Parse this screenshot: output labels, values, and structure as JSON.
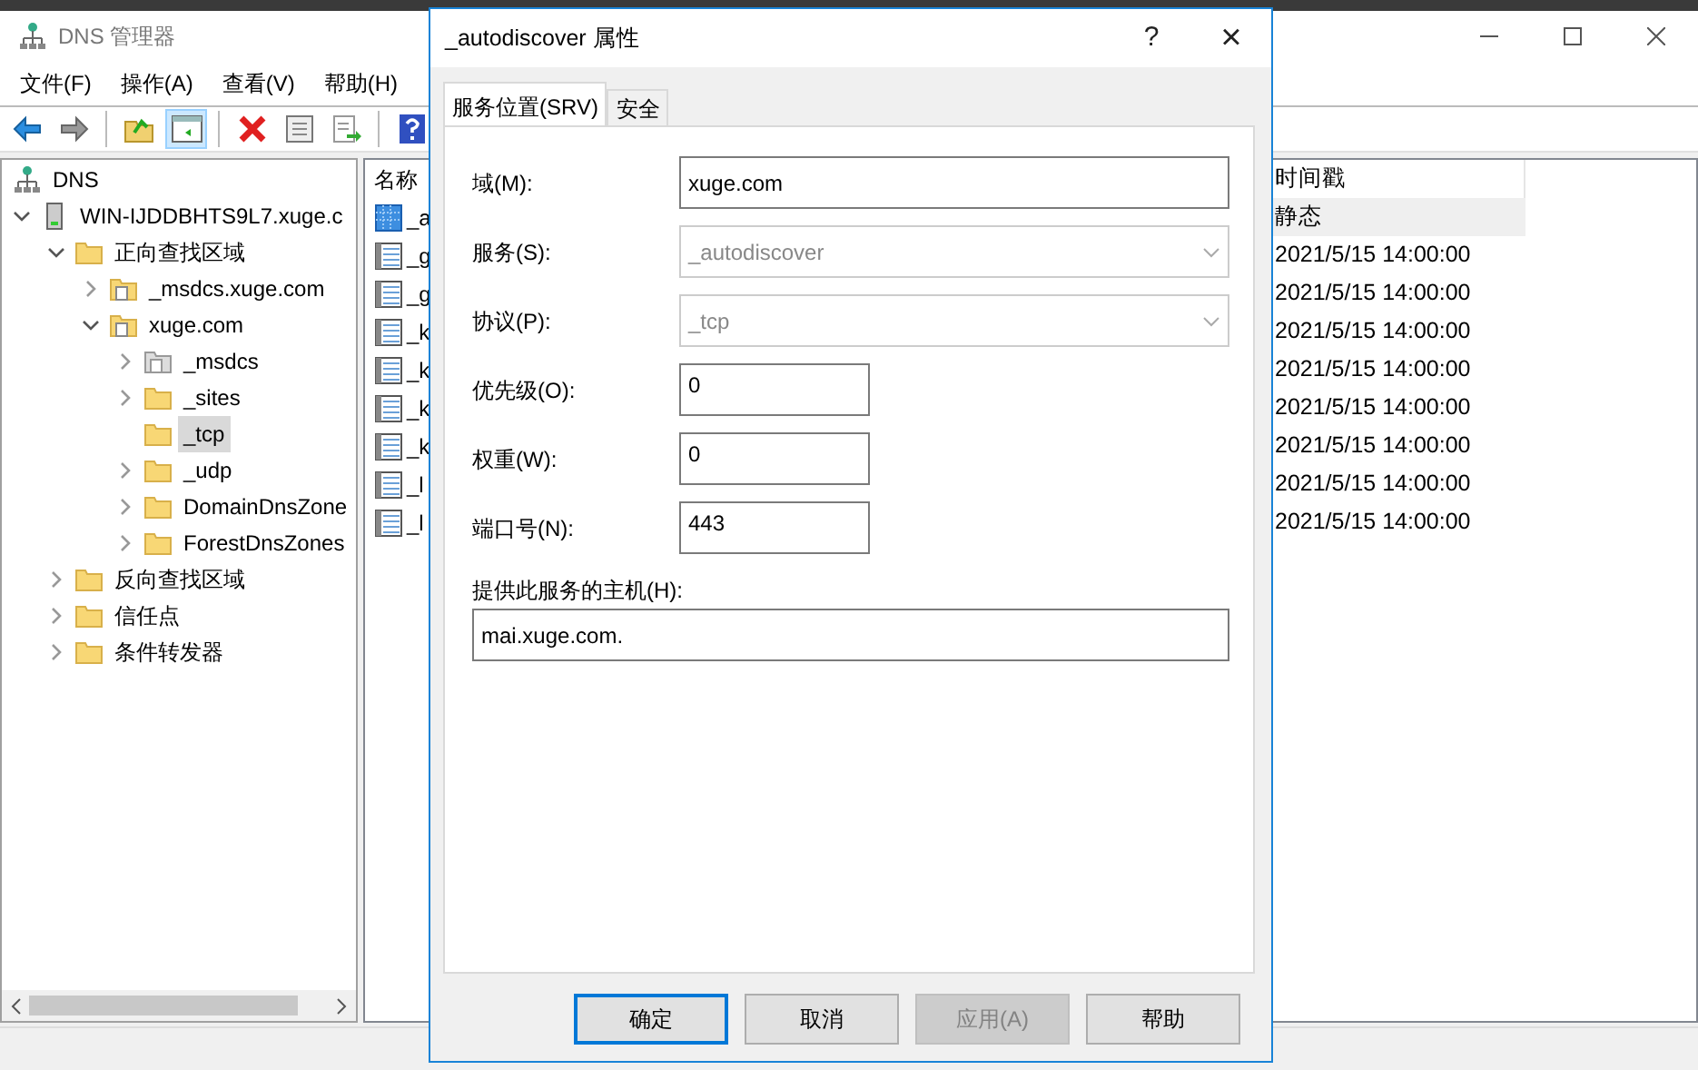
{
  "window": {
    "title": "DNS 管理器"
  },
  "menu": [
    "文件(F)",
    "操作(A)",
    "查看(V)",
    "帮助(H)"
  ],
  "toolbar": [
    {
      "kind": "back",
      "selected": false
    },
    {
      "kind": "forward",
      "selected": false
    },
    {
      "kind": "separator"
    },
    {
      "kind": "up",
      "selected": false
    },
    {
      "kind": "pane",
      "selected": true
    },
    {
      "kind": "separator"
    },
    {
      "kind": "delete",
      "selected": false
    },
    {
      "kind": "properties",
      "selected": false
    },
    {
      "kind": "export",
      "selected": false
    },
    {
      "kind": "separator"
    },
    {
      "kind": "help",
      "selected": false
    }
  ],
  "tree": [
    {
      "label": "DNS",
      "kind": "dns",
      "selected": false,
      "children": [
        {
          "label": "WIN-IJDDBHTS9L7.xuge.c",
          "kind": "server",
          "selected": false,
          "expanded": true,
          "children": [
            {
              "label": "正向查找区域",
              "kind": "folder",
              "selected": false,
              "expanded": true,
              "children": [
                {
                  "label": "_msdcs.xuge.com",
                  "kind": "zone",
                  "selected": false,
                  "expanded": false
                },
                {
                  "label": "xuge.com",
                  "kind": "zone",
                  "selected": false,
                  "expanded": true,
                  "children": [
                    {
                      "label": "_msdcs",
                      "kind": "delegated",
                      "selected": false,
                      "expanded": false
                    },
                    {
                      "label": "_sites",
                      "kind": "folder",
                      "selected": false,
                      "expanded": false
                    },
                    {
                      "label": "_tcp",
                      "kind": "folder",
                      "selected": true
                    },
                    {
                      "label": "_udp",
                      "kind": "folder",
                      "selected": false,
                      "expanded": false
                    },
                    {
                      "label": "DomainDnsZone",
                      "kind": "folder",
                      "selected": false,
                      "expanded": false
                    },
                    {
                      "label": "ForestDnsZones",
                      "kind": "folder",
                      "selected": false,
                      "expanded": false
                    }
                  ]
                }
              ]
            },
            {
              "label": "反向查找区域",
              "kind": "folder",
              "selected": false,
              "expanded": false
            },
            {
              "label": "信任点",
              "kind": "folder",
              "selected": false,
              "expanded": false
            },
            {
              "label": "条件转发器",
              "kind": "folder",
              "selected": false,
              "expanded": false
            }
          ]
        }
      ]
    }
  ],
  "list": {
    "columns": [
      "名称",
      "时间戳"
    ],
    "rows": [
      {
        "name": "_a",
        "timestamp": "静态",
        "selected": true
      },
      {
        "name": "_g",
        "timestamp": "2021/5/15 14:00:00",
        "selected": false
      },
      {
        "name": "_g",
        "timestamp": "2021/5/15 14:00:00",
        "selected": false
      },
      {
        "name": "_k",
        "timestamp": "2021/5/15 14:00:00",
        "selected": false
      },
      {
        "name": "_k",
        "timestamp": "2021/5/15 14:00:00",
        "selected": false
      },
      {
        "name": "_k",
        "timestamp": "2021/5/15 14:00:00",
        "selected": false
      },
      {
        "name": "_k",
        "timestamp": "2021/5/15 14:00:00",
        "selected": false
      },
      {
        "name": "_l",
        "timestamp": "2021/5/15 14:00:00",
        "selected": false
      },
      {
        "name": "_l",
        "timestamp": "2021/5/15 14:00:00",
        "selected": false
      }
    ]
  },
  "dialog": {
    "title": "_autodiscover 属性",
    "help": "?",
    "close": "×",
    "tabs": [
      {
        "label": "服务位置(SRV)",
        "selected": true
      },
      {
        "label": "安全",
        "selected": false
      }
    ],
    "fields": [
      {
        "kind": "text",
        "label": "域(M):",
        "value": "xuge.com",
        "disabled": false
      },
      {
        "kind": "select",
        "label": "服务(S):",
        "value": "_autodiscover",
        "disabled": true
      },
      {
        "kind": "select",
        "label": "协议(P):",
        "value": "_tcp",
        "disabled": true
      },
      {
        "kind": "short",
        "label": "优先级(O):",
        "value": "0",
        "disabled": false
      },
      {
        "kind": "short",
        "label": "权重(W):",
        "value": "0",
        "disabled": false
      },
      {
        "kind": "short",
        "label": "端口号(N):",
        "value": "443",
        "disabled": false
      },
      {
        "kind": "block",
        "label": "提供此服务的主机(H):",
        "value": "mai.xuge.com.",
        "disabled": false
      }
    ],
    "buttons": [
      {
        "label": "确定",
        "default": true,
        "disabled": false
      },
      {
        "label": "取消",
        "default": false,
        "disabled": false
      },
      {
        "label": "应用(A)",
        "default": false,
        "disabled": true
      },
      {
        "label": "帮助",
        "default": false,
        "disabled": false
      }
    ]
  }
}
